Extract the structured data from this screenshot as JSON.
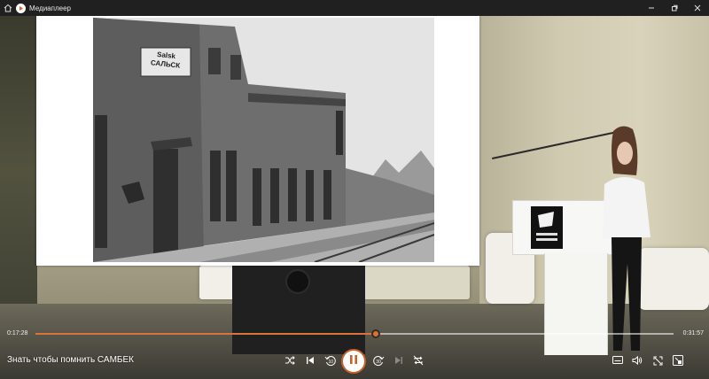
{
  "window": {
    "title": "Медиаплеер"
  },
  "player": {
    "elapsed": "0:17:28",
    "total": "0:31:57",
    "progress_fraction": 0.534,
    "video_title": "Знать чтобы помнить САМБЕК",
    "accent_color": "#d8733b"
  },
  "photo": {
    "sign_text": "Salsk САЛЬСК"
  },
  "icons": {
    "home": "home-icon",
    "app": "media-player-logo-icon",
    "minimize": "minimize-icon",
    "maximize": "maximize-icon",
    "close": "close-icon",
    "shuffle": "shuffle-icon",
    "previous": "skip-previous-icon",
    "back10": "rewind-10-icon",
    "pause": "pause-icon",
    "forward30": "forward-30-icon",
    "next": "skip-next-icon",
    "repeat": "repeat-icon",
    "subtitles": "subtitles-icon",
    "volume": "volume-icon",
    "fullscreen": "fullscreen-icon",
    "miniplayer": "miniplayer-icon"
  }
}
